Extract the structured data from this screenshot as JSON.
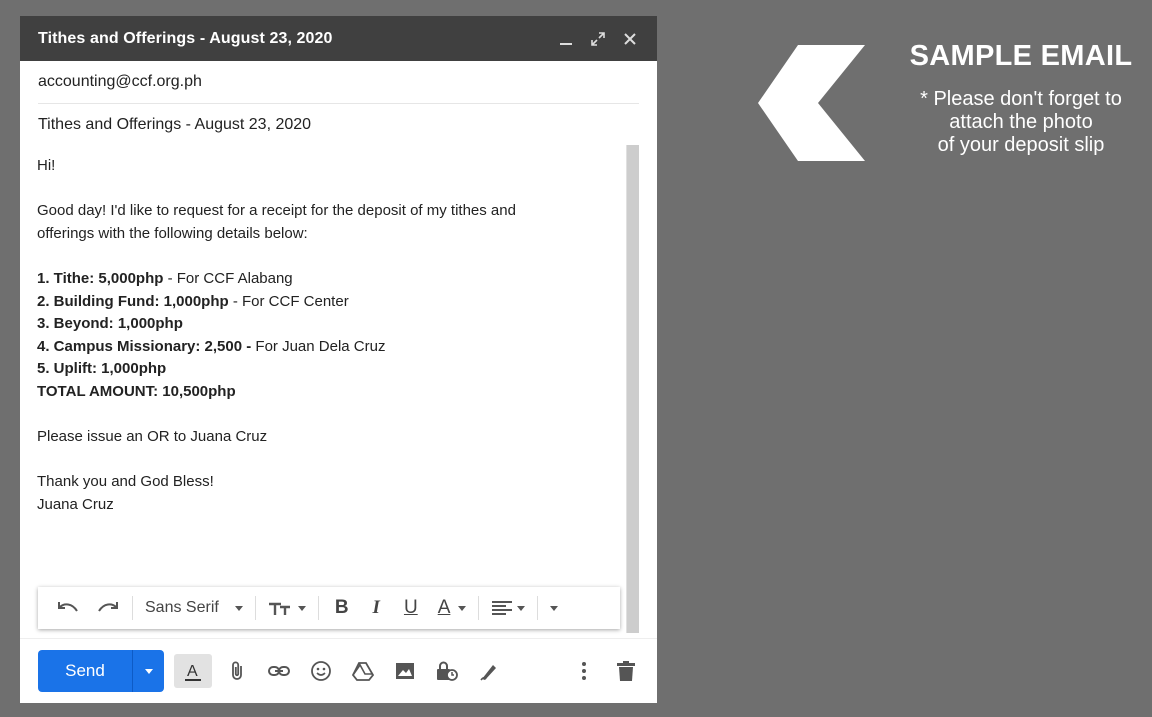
{
  "window": {
    "title": "Tithes and Offerings - August 23, 2020",
    "to": "accounting@ccf.org.ph",
    "subject": "Tithes and Offerings - August 23, 2020"
  },
  "body": {
    "greeting": "Hi!",
    "intro_line1": "Good day! I'd like to request for a receipt for the deposit of my tithes and",
    "intro_line2": "offerings with the following details below:",
    "items": [
      {
        "label": "1. Tithe: 5,000php",
        "note": " - For CCF Alabang"
      },
      {
        "label": "2. Building Fund: 1,000php",
        "note": " - For CCF Center"
      },
      {
        "label": "3. Beyond: 1,000php",
        "note": ""
      },
      {
        "label": "4. Campus Missionary: 2,500 - ",
        "note": "For Juan Dela Cruz"
      },
      {
        "label": "5. Uplift: 1,000php",
        "note": ""
      }
    ],
    "total_label": "TOTAL AMOUNT: 10,500php",
    "request": "Please issue an OR to Juana Cruz",
    "thanks": "Thank you and God Bless!",
    "signature": "Juana Cruz"
  },
  "format_toolbar": {
    "font": "Sans Serif"
  },
  "send": {
    "label": "Send"
  },
  "annotation": {
    "title": "SAMPLE EMAIL",
    "note_line1": "* Please don't forget to",
    "note_line2": "attach the photo",
    "note_line3": "of your deposit slip"
  },
  "icons": {
    "titlebar": [
      "minimize-icon",
      "expand-icon",
      "close-icon"
    ],
    "format": [
      "undo-icon",
      "redo-icon",
      "text-size-icon",
      "bold-icon",
      "italic-icon",
      "underline-icon",
      "text-color-icon",
      "align-icon",
      "more-formatting-icon"
    ],
    "bottom": [
      "formatting-options-icon",
      "attach-icon",
      "link-icon",
      "emoji-icon",
      "drive-icon",
      "photo-icon",
      "confidential-mode-icon",
      "signature-icon",
      "more-options-icon",
      "trash-icon"
    ]
  },
  "colors": {
    "background": "#6f6f6f",
    "titlebar": "#404040",
    "send_button": "#1a73e8"
  }
}
